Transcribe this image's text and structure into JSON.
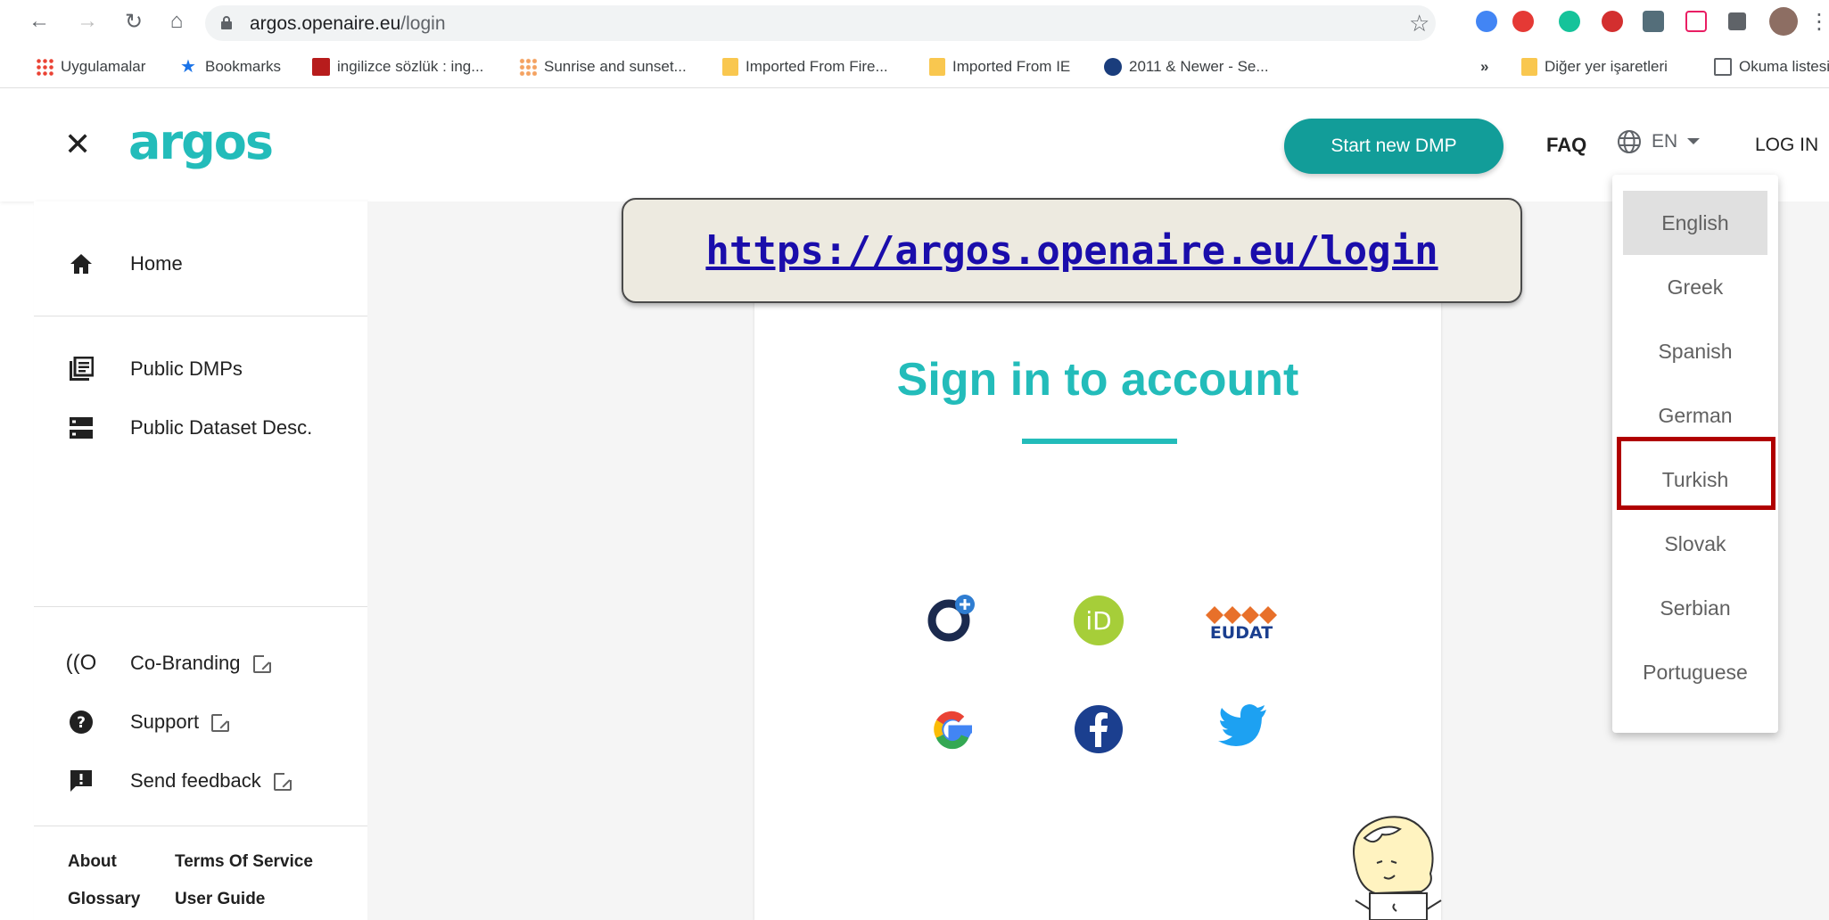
{
  "browser": {
    "url_host": "argos.openaire.eu",
    "url_path": "/login",
    "bookmarks": [
      {
        "label": "Uygulamalar"
      },
      {
        "label": "Bookmarks"
      },
      {
        "label": "ingilizce sözlük : ing..."
      },
      {
        "label": "Sunrise and sunset..."
      },
      {
        "label": "Imported From Fire..."
      },
      {
        "label": "Imported From IE"
      },
      {
        "label": "2011 & Newer - Se..."
      }
    ],
    "overflow": "»",
    "other_bookmarks": "Diğer yer işaretleri",
    "reading_list": "Okuma listesi"
  },
  "header": {
    "logo": "argos",
    "start_button": "Start new DMP",
    "faq": "FAQ",
    "language": "EN",
    "login": "LOG IN"
  },
  "sidebar": {
    "home": "Home",
    "public_dmps": "Public DMPs",
    "public_datasets": "Public Dataset Desc.",
    "co_branding": "Co-Branding",
    "support": "Support",
    "feedback": "Send feedback",
    "footer": {
      "about": "About",
      "terms": "Terms Of Service",
      "glossary": "Glossary",
      "user_guide": "User Guide"
    }
  },
  "main": {
    "url_banner": "https://argos.openaire.eu/login",
    "title": "Sign in to account",
    "eudat_label": "EUDAT"
  },
  "language_menu": {
    "options": [
      "English",
      "Greek",
      "Spanish",
      "German",
      "Turkish",
      "Slovak",
      "Serbian",
      "Portuguese"
    ],
    "selected": "English",
    "highlighted": "Turkish"
  },
  "colors": {
    "brand": "#23bcba",
    "button": "#129d99",
    "highlight": "#b00000"
  }
}
